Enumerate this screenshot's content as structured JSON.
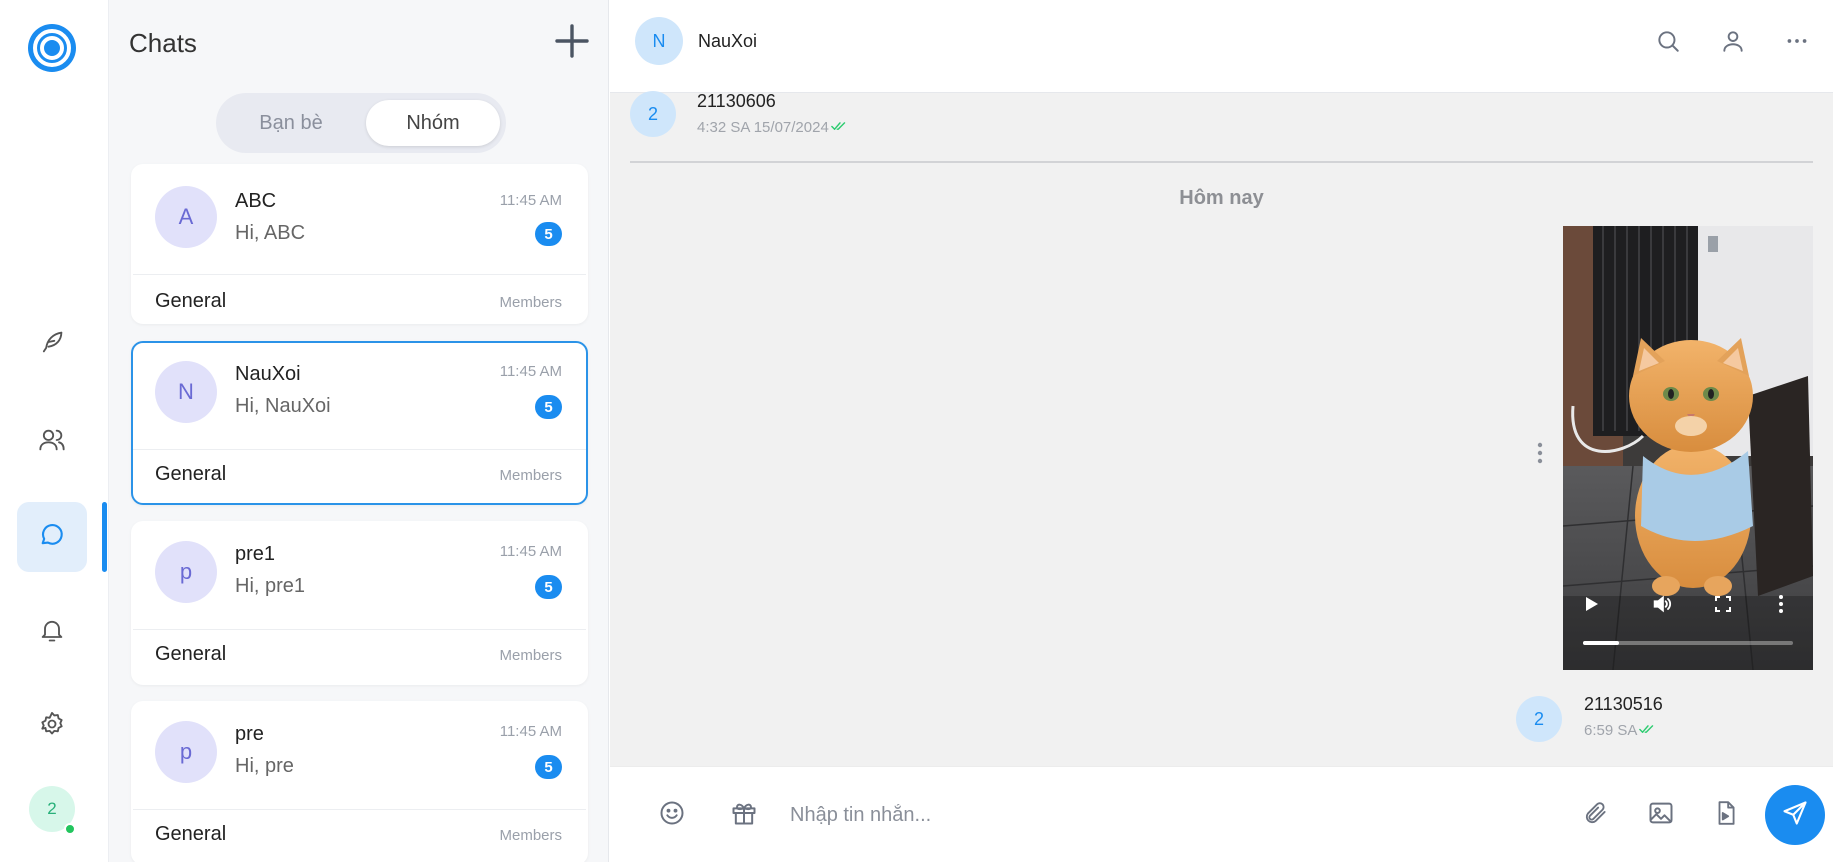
{
  "sidebar": {
    "icons": [
      "logo-icon",
      "feather-icon",
      "users-icon",
      "chat-icon",
      "bell-icon",
      "gear-icon"
    ],
    "avatar_label": "2"
  },
  "chat_list": {
    "title": "Chats",
    "tabs": {
      "friends": "Bạn bè",
      "groups": "Nhóm"
    },
    "items": [
      {
        "initial": "A",
        "name": "ABC",
        "last": "Hi, ABC",
        "time": "11:45 AM",
        "badge": "5",
        "group": "General",
        "members": "Members"
      },
      {
        "initial": "N",
        "name": "NauXoi",
        "last": "Hi, NauXoi",
        "time": "11:45 AM",
        "badge": "5",
        "group": "General",
        "members": "Members"
      },
      {
        "initial": "p",
        "name": "pre1",
        "last": "Hi, pre1",
        "time": "11:45 AM",
        "badge": "5",
        "group": "General",
        "members": "Members"
      },
      {
        "initial": "p",
        "name": "pre",
        "last": "Hi, pre",
        "time": "11:45 AM",
        "badge": "5",
        "group": "General",
        "members": "Members"
      }
    ]
  },
  "conversation": {
    "header": {
      "initial": "N",
      "name": "NauXoi"
    },
    "messages": [
      {
        "initial": "2",
        "text": "21130606",
        "meta": "4:32 SA 15/07/2024"
      },
      {
        "initial": "2",
        "text": "21130516",
        "meta": "6:59 SA"
      }
    ],
    "day_label": "Hôm nay",
    "video": {
      "progress": 0.17
    },
    "composer": {
      "placeholder": "Nhập tin nhắn..."
    }
  },
  "colors": {
    "accent": "#1a8cf0",
    "selected_border": "#2b93e8",
    "online": "#22c55e",
    "read_check": "#2ecc71"
  }
}
